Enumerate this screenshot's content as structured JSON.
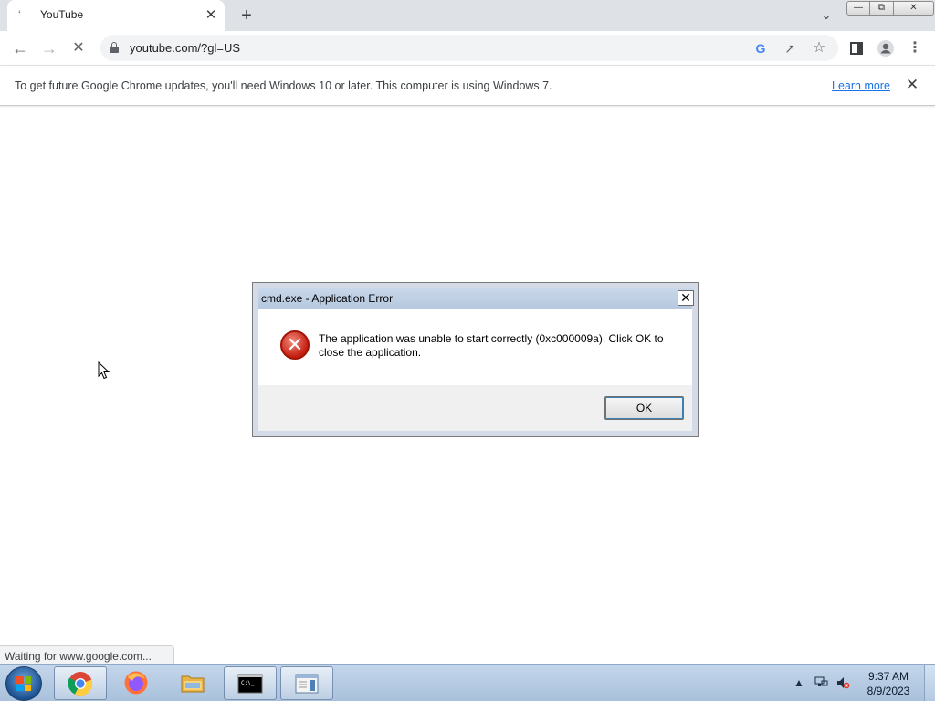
{
  "browser": {
    "tab": {
      "title": "YouTube",
      "favicon": "loading-favicon-icon",
      "close_icon": "close-icon"
    },
    "new_tab_icon": "plus-icon",
    "tab_search_icon": "chevron-down-icon",
    "window_controls": {
      "minimize": "minimize-icon",
      "maximize": "restore-icon",
      "close": "close-icon"
    },
    "toolbar": {
      "back_icon": "arrow-left-icon",
      "forward_icon": "arrow-right-icon",
      "stop_icon": "close-icon",
      "url": "youtube.com/?gl=US",
      "lock_icon": "lock-icon",
      "google_icon": "google-icon",
      "share_icon": "share-icon",
      "bookmark_icon": "star-icon",
      "side_panel_icon": "side-panel-icon",
      "profile_icon": "profile-icon",
      "menu_icon": "kebab-menu-icon"
    },
    "infobar": {
      "message": "To get future Google Chrome updates, you'll need Windows 10 or later. This computer is using Windows 7.",
      "link": "Learn more",
      "close_icon": "close-icon"
    },
    "status_text": "Waiting for www.google.com..."
  },
  "dialog": {
    "title": "cmd.exe - Application Error",
    "message": "The application was unable to start correctly (0xc000009a). Click OK to close the application.",
    "ok_label": "OK",
    "icon": "error-icon"
  },
  "taskbar": {
    "apps": [
      {
        "name": "Google Chrome",
        "icon": "chrome-icon",
        "active": true
      },
      {
        "name": "Firefox",
        "icon": "firefox-icon",
        "active": false
      },
      {
        "name": "Windows Explorer",
        "icon": "folder-icon",
        "active": false
      },
      {
        "name": "Command Prompt",
        "icon": "terminal-icon",
        "active": true
      },
      {
        "name": "Application Window",
        "icon": "window-icon",
        "active": true
      }
    ],
    "tray_icons": [
      "tray-expand-icon",
      "network-icon",
      "volume-muted-icon"
    ],
    "clock": {
      "time": "9:37 AM",
      "date": "8/9/2023"
    }
  },
  "colors": {
    "chrome_tabstrip": "#dee1e6",
    "omnibox": "#f1f3f4",
    "link": "#1a73e8",
    "taskbar": "#b5cbe3",
    "error_red": "#c41e10"
  }
}
